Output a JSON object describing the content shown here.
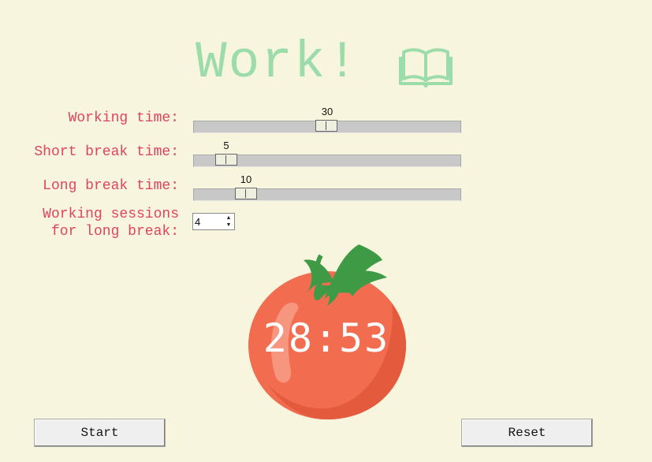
{
  "header": {
    "title": "Work!",
    "icon": "book-icon"
  },
  "settings": {
    "working_time": {
      "label": "Working time:",
      "value": "30",
      "fraction": 0.5
    },
    "short_break": {
      "label": "Short break time:",
      "value": "5",
      "fraction": 0.1
    },
    "long_break": {
      "label": "Long break time:",
      "value": "10",
      "fraction": 0.2
    },
    "sessions": {
      "label": "Working sessions\nfor long break:",
      "value": "4"
    }
  },
  "timer": {
    "display": "28:53",
    "icon": "tomato-icon"
  },
  "buttons": {
    "start": "Start",
    "reset": "Reset"
  },
  "colors": {
    "background": "#f7f5dd",
    "title": "#9bdcaa",
    "label": "#e0445d",
    "tomato": "#f26c4f"
  }
}
